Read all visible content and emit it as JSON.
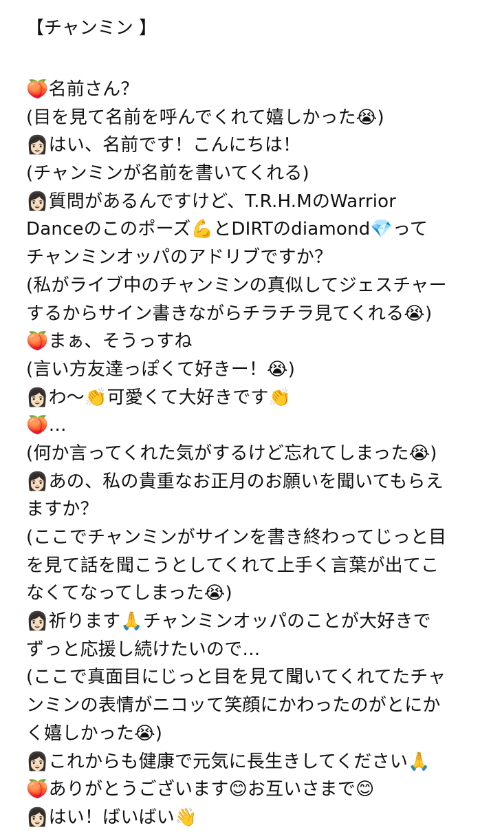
{
  "title": "【チャンミン 】",
  "lines": [
    "🍑名前さん？",
    "(目を見て名前を呼んでくれて嬉しかった😭)",
    "👩🏻はい、名前です！こんにちは！",
    "(チャンミンが名前を書いてくれる)",
    "👩🏻質問があるんですけど、T.R.H.MのWarrior",
    "Danceのこのポーズ💪とDIRTのdiamond💎って",
    "チャンミンオッパのアドリブですか？",
    "(私がライブ中のチャンミンの真似してジェスチャー",
    "するからサイン書きながらチラチラ見てくれる😭)",
    "🍑まぁ、そうっすね",
    "(言い方友達っぽくて好きー！😭)",
    "👩🏻わ〜👏可愛くて大好きです👏",
    "🍑…",
    "(何か言ってくれた気がするけど忘れてしまった😭)",
    "👩🏻あの、私の貴重なお正月のお願いを聞いてもらえ",
    "ますか？",
    "(ここでチャンミンがサインを書き終わってじっと目",
    "を見て話を聞こうとしてくれて上手く言葉が出てこ",
    "なくてなってしまった😭)",
    "👩🏻祈ります🙏チャンミンオッパのことが大好きで",
    "ずっと応援し続けたいので…",
    "(ここで真面目にじっと目を見て聞いてくれてたチャ",
    "ンミンの表情がニコッて笑顔にかわったのがとにか",
    "く嬉しかった😭)",
    "👩🏻これからも健康で元気に長生きしてください🙏",
    "🍑ありがとうございます😊お互いさまで😊",
    "👩🏻はい！ばいばい👋"
  ]
}
